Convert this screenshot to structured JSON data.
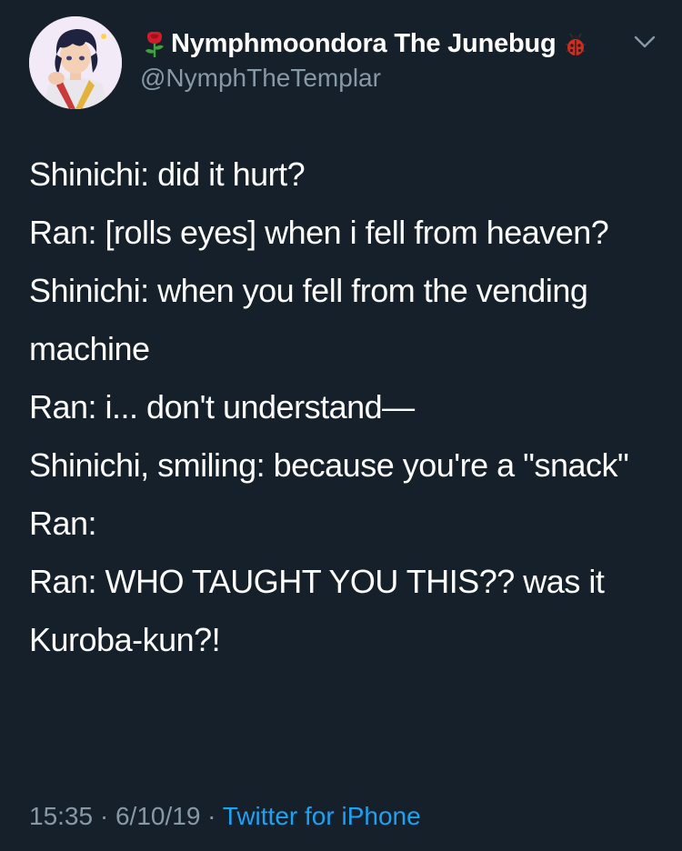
{
  "user": {
    "display_name": "Nymphmoondora The Junebug",
    "handle": "@NymphTheTemplar",
    "name_prefix_icon": "rose-icon",
    "name_suffix_icon": "ladybug-icon"
  },
  "menu": {
    "icon": "chevron-down-icon"
  },
  "tweet": {
    "lines": [
      "Shinichi: did it hurt?",
      "Ran: [rolls eyes] when i fell from heaven?",
      "Shinichi: when you fell from the vending machine",
      "Ran: i... don't understand—",
      "Shinichi, smiling: because you're a \"snack\"",
      "Ran:",
      "Ran: WHO TAUGHT YOU THIS?? was it Kuroba-kun?!"
    ]
  },
  "meta": {
    "time": "15:35",
    "separator": "·",
    "date": "6/10/19",
    "source": "Twitter for iPhone"
  },
  "colors": {
    "background": "#15202b",
    "text": "#ffffff",
    "secondary": "#8899a6",
    "link": "#1da1f2"
  }
}
